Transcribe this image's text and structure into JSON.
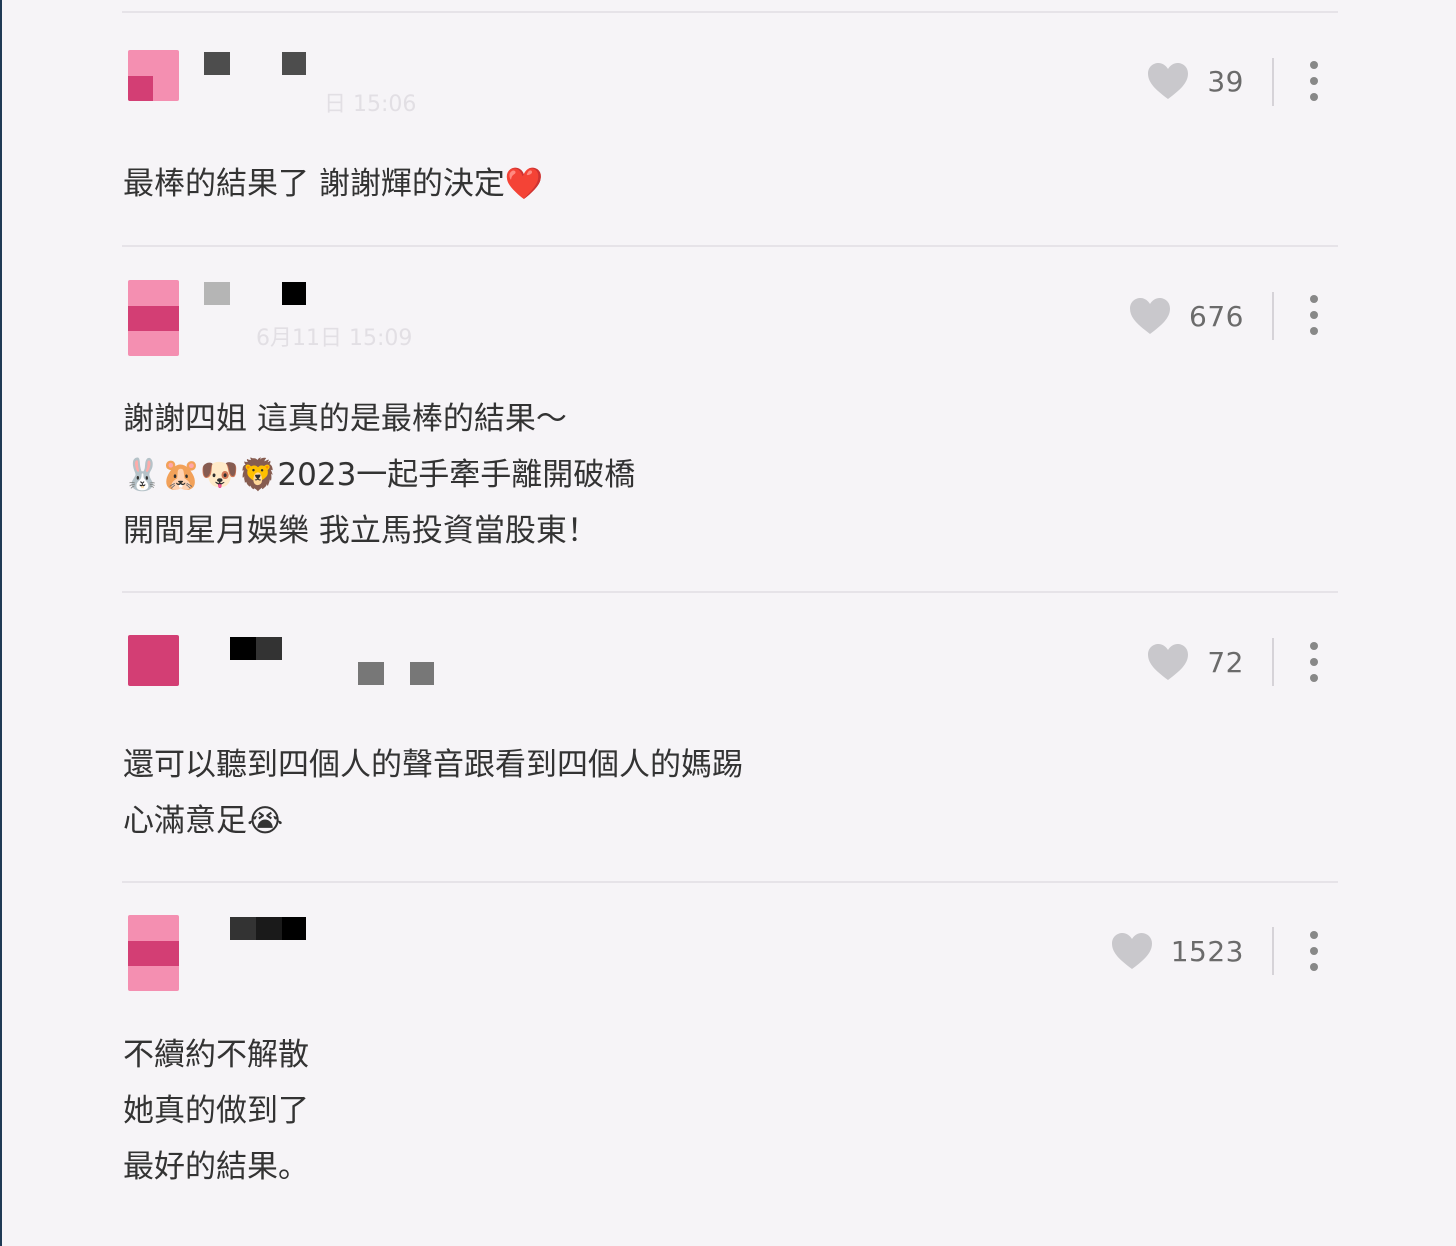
{
  "comments": [
    {
      "likes": "39",
      "lines": [
        "最棒的結果了 謝謝輝的決定❤️"
      ]
    },
    {
      "likes": "676",
      "timestamp": "6月11日 15:09",
      "lines": [
        "謝謝四姐 這真的是最棒的結果～",
        "🐰🐹🐶🦁2023一起手牽手離開破橋",
        "開間星月娛樂 我立馬投資當股東！"
      ]
    },
    {
      "likes": "72",
      "lines": [
        "還可以聽到四個人的聲音跟看到四個人的媽踢",
        "心滿意足😭"
      ]
    },
    {
      "likes": "1523",
      "lines": [
        "不續約不解散",
        "她真的做到了",
        "最好的結果。"
      ]
    }
  ],
  "colors": {
    "background": "#f6f4f7",
    "avatar_pink": "#f48fb1",
    "avatar_magenta": "#d33e74",
    "heart": "#c9c8cc",
    "text": "#333333",
    "count": "#6b6b6b"
  },
  "icons": {
    "like": "heart-icon",
    "menu": "more-vertical-icon"
  }
}
